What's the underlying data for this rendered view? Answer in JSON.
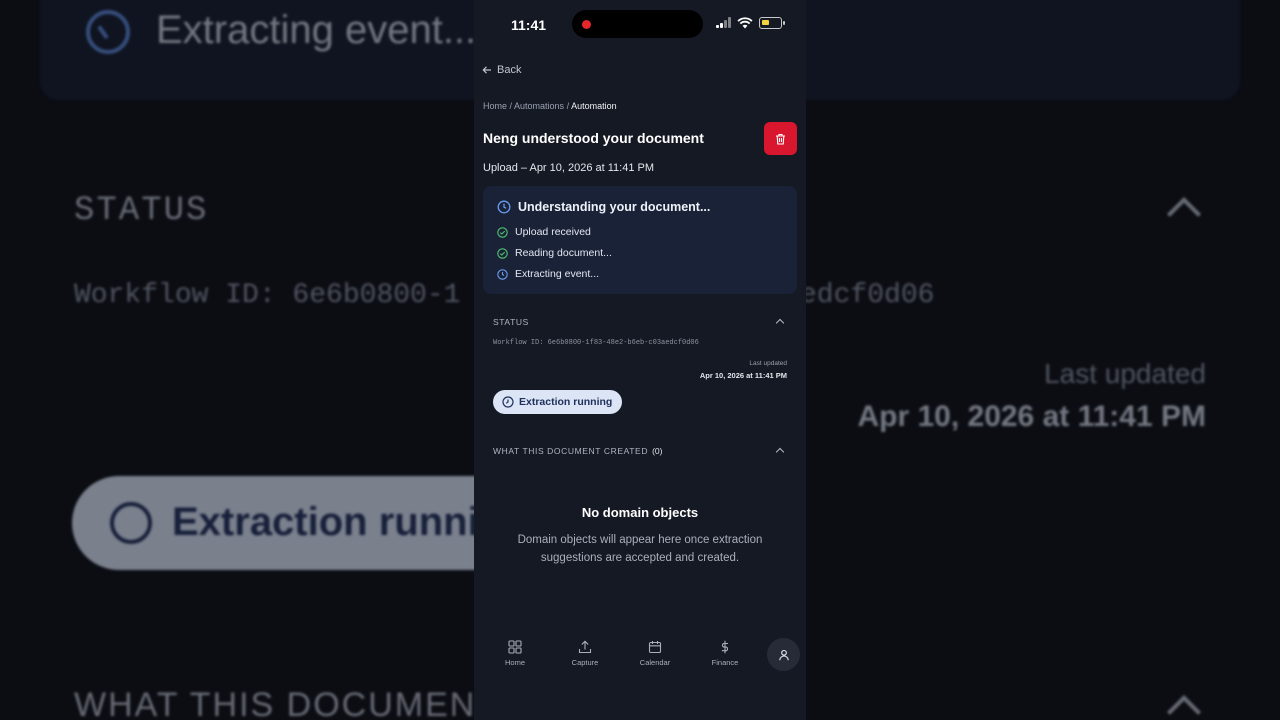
{
  "background_echo": {
    "extracting": "Extracting event...",
    "status": "STATUS",
    "workflow_left": "Workflow ID: 6e6b0800-1",
    "workflow_right": "edcf0d06",
    "last_updated_label": "Last updated",
    "last_updated_value": "Apr 10, 2026 at 11:41 PM",
    "pill": "Extraction running",
    "what": "WHAT THIS DOCUMENT CREATED"
  },
  "status_bar": {
    "time": "11:41",
    "recording_color": "#e5262b",
    "battery_color": "#f5d33d"
  },
  "nav": {
    "back_label": "Back"
  },
  "breadcrumb": {
    "home": "Home",
    "sep1": " / ",
    "automations": "Automations",
    "sep2": " / ",
    "current": "Automation"
  },
  "header": {
    "title": "Neng understood your document",
    "delete_icon": "trash-icon",
    "delete_color": "#d8162d",
    "upload_line": "Upload – Apr 10, 2026 at 11:41 PM"
  },
  "progress": {
    "heading": "Understanding your document...",
    "steps": [
      {
        "label": "Upload received",
        "state": "done",
        "icon": "check-circle-icon"
      },
      {
        "label": "Reading document...",
        "state": "done",
        "icon": "check-circle-icon"
      },
      {
        "label": "Extracting event...",
        "state": "running",
        "icon": "clock-icon"
      }
    ],
    "done_color": "#4fc36d",
    "running_color": "#6b9cf0"
  },
  "status_section": {
    "heading": "STATUS",
    "workflow_id": "Workflow ID: 6e6b0800-1f83-48e2-b6eb-c03aedcf0d06",
    "last_updated_label": "Last updated",
    "last_updated_value": "Apr 10, 2026 at 11:41 PM",
    "status_pill": "Extraction running"
  },
  "created_section": {
    "heading": "WHAT THIS DOCUMENT CREATED",
    "count": "(0)",
    "empty_title": "No domain objects",
    "empty_desc": "Domain objects will appear here once extraction suggestions are accepted and created."
  },
  "tabbar": {
    "tabs": [
      {
        "label": "Home",
        "icon": "grid-icon"
      },
      {
        "label": "Capture",
        "icon": "upload-icon"
      },
      {
        "label": "Calendar",
        "icon": "calendar-icon"
      },
      {
        "label": "Finance",
        "icon": "dollar-icon"
      }
    ],
    "profile_icon": "user-icon"
  }
}
